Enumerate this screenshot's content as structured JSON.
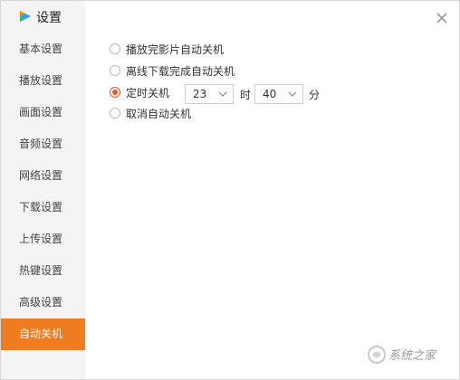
{
  "app": {
    "title": "设置",
    "accent_color": "#f07c22",
    "radio_color": "#e8562a"
  },
  "sidebar": {
    "items": [
      {
        "label": "基本设置",
        "active": false
      },
      {
        "label": "播放设置",
        "active": false
      },
      {
        "label": "画面设置",
        "active": false
      },
      {
        "label": "音频设置",
        "active": false
      },
      {
        "label": "网络设置",
        "active": false
      },
      {
        "label": "下载设置",
        "active": false
      },
      {
        "label": "上传设置",
        "active": false
      },
      {
        "label": "热键设置",
        "active": false
      },
      {
        "label": "高级设置",
        "active": false
      },
      {
        "label": "自动关机",
        "active": true
      }
    ]
  },
  "main": {
    "options": [
      {
        "label": "播放完影片自动关机",
        "checked": false
      },
      {
        "label": "离线下载完成自动关机",
        "checked": false
      },
      {
        "label": "定时关机",
        "checked": true
      },
      {
        "label": "取消自动关机",
        "checked": false
      }
    ],
    "timer": {
      "hour_value": "23",
      "hour_unit": "时",
      "minute_value": "40",
      "minute_unit": "分"
    }
  },
  "icons": {
    "logo": "video-app-logo-icon",
    "close": "close-icon",
    "dropdown": "chevron-down-icon"
  },
  "watermark": {
    "text": "系统之家"
  }
}
